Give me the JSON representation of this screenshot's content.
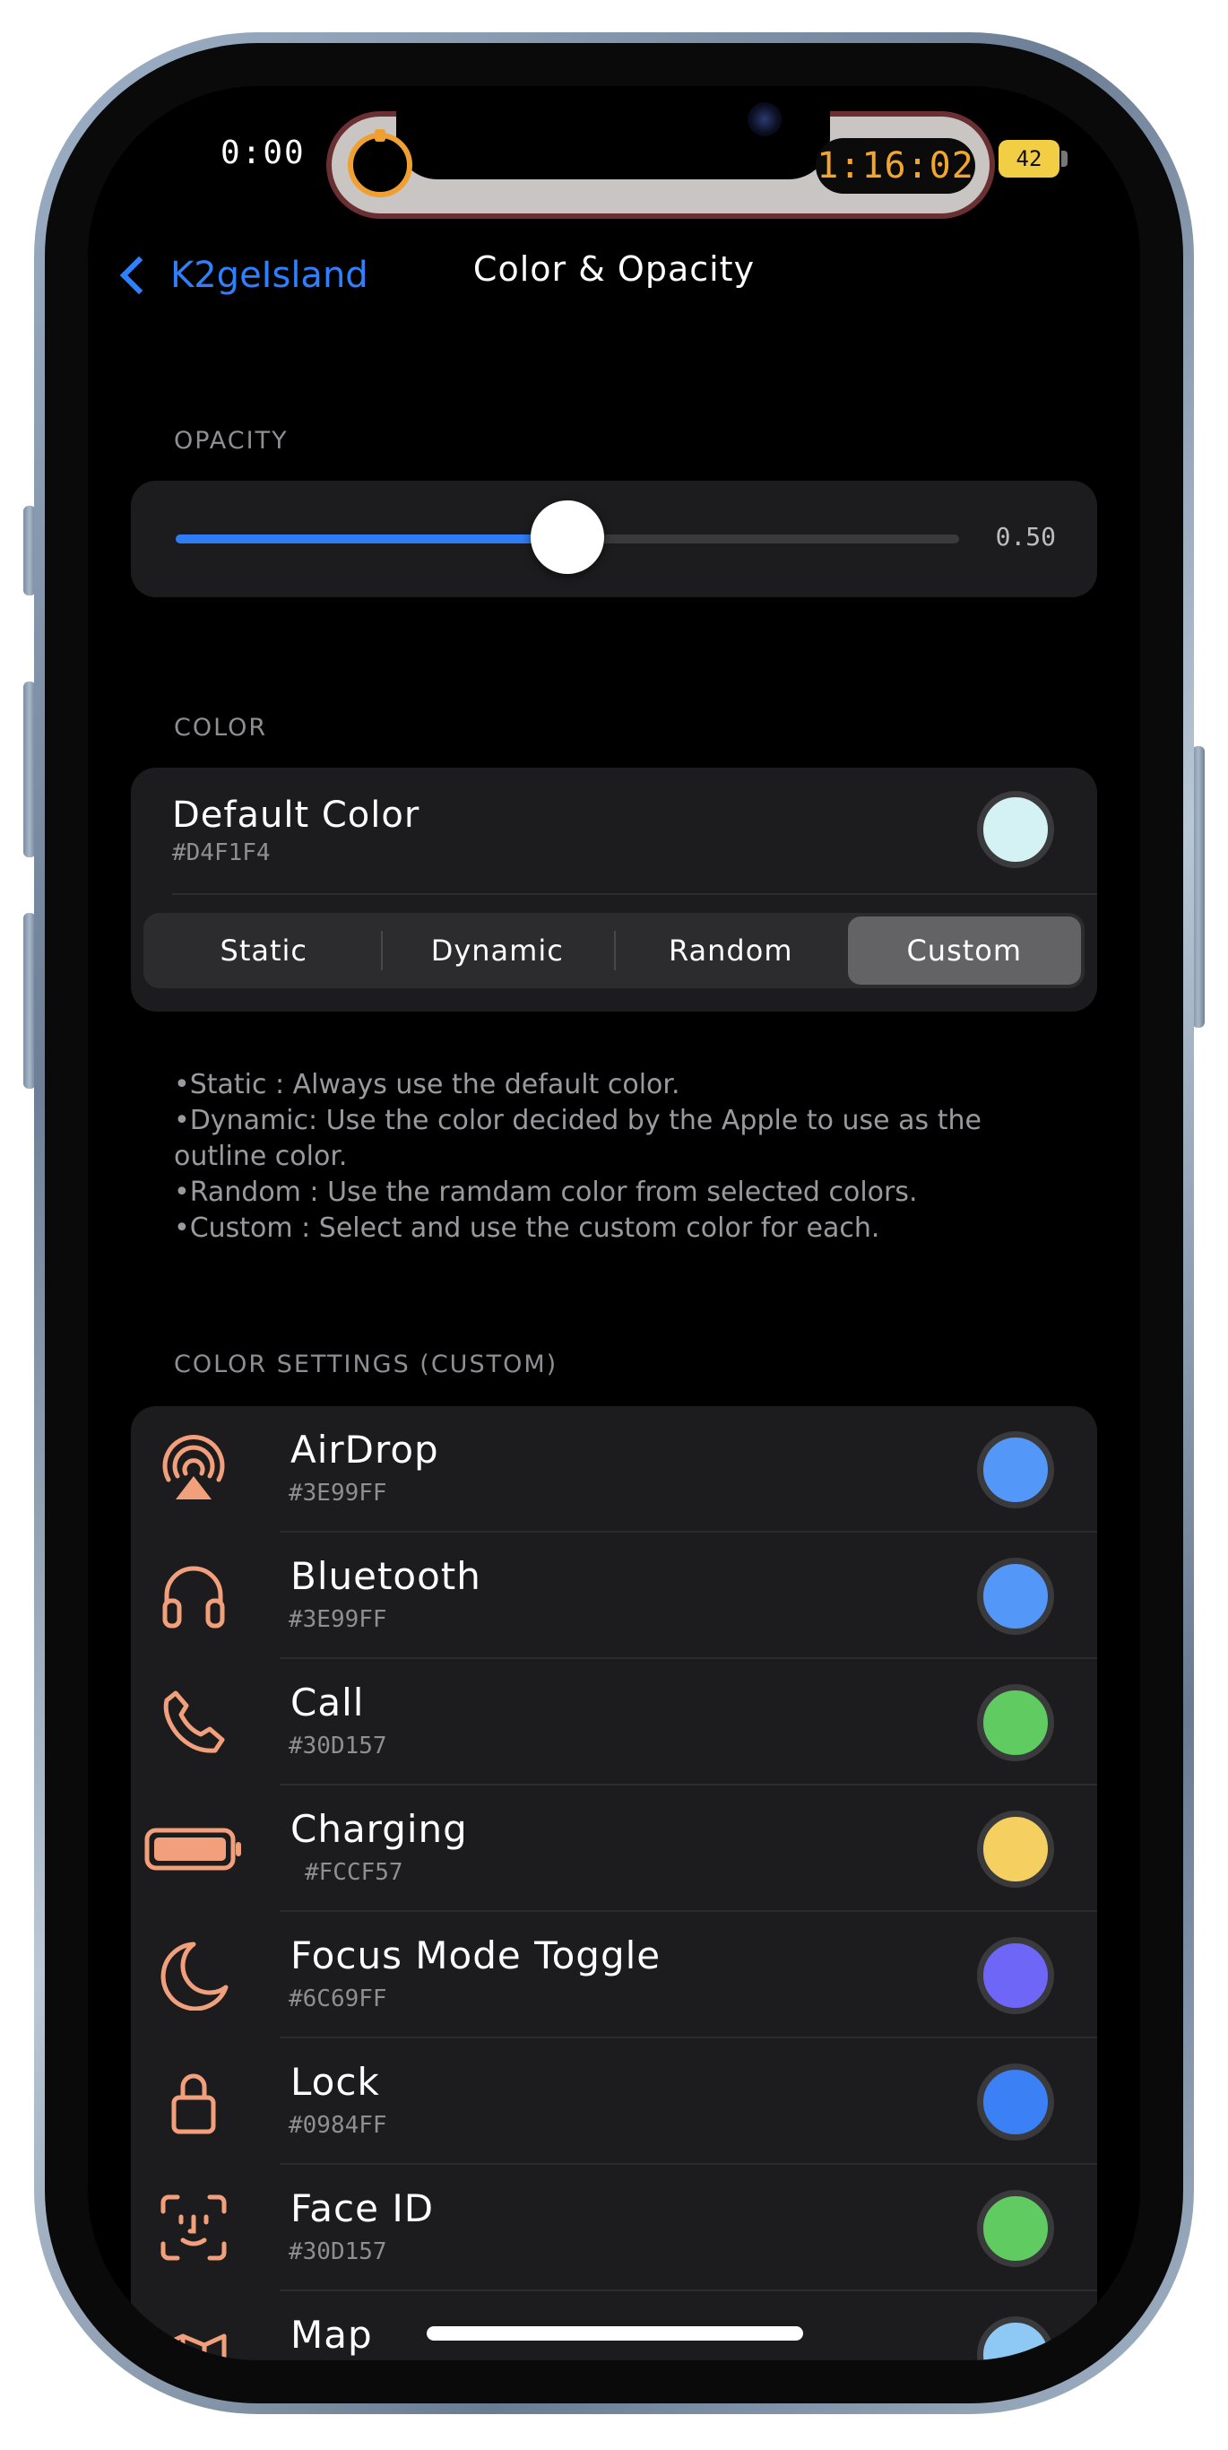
{
  "status": {
    "time": "0:00",
    "island_timer": "1:16:02",
    "battery": "42"
  },
  "nav": {
    "back_label": "K2geIsland",
    "title": "Color & Opacity"
  },
  "opacity": {
    "header": "OPACITY",
    "value": 0.5,
    "value_label": "0.50"
  },
  "color": {
    "header": "COLOR",
    "default_title": "Default Color",
    "default_hex": "#D4F1F4",
    "default_swatch": "#D4F1F4",
    "segments": [
      "Static",
      "Dynamic",
      "Random",
      "Custom"
    ],
    "selected_segment": "Custom",
    "notes": [
      "•Static : Always use the default color.",
      "•Dynamic: Use the color decided by the Apple to use as the",
      "outline color.",
      "•Random : Use the ramdam color from selected colors.",
      "•Custom : Select and use the custom color for each."
    ]
  },
  "custom": {
    "header": "COLOR SETTINGS (CUSTOM)",
    "icon_color": "#F2A07B",
    "items": [
      {
        "label": "AirDrop",
        "hex": "#3E99FF",
        "swatch": "#5397F8",
        "icon": "airdrop-icon"
      },
      {
        "label": "Bluetooth",
        "hex": "#3E99FF",
        "swatch": "#5397F8",
        "icon": "headphones-icon"
      },
      {
        "label": "Call",
        "hex": "#30D157",
        "swatch": "#5FCB60",
        "icon": "phone-icon"
      },
      {
        "label": "Charging",
        "hex": "#FCCF57",
        "swatch": "#F5D061",
        "icon": "battery-icon"
      },
      {
        "label": "Focus Mode Toggle",
        "hex": "#6C69FF",
        "swatch": "#6E66F6",
        "icon": "moon-icon"
      },
      {
        "label": "Lock",
        "hex": "#0984FF",
        "swatch": "#3C80F5",
        "icon": "lock-icon"
      },
      {
        "label": "Face ID",
        "hex": "#30D157",
        "swatch": "#5FCB60",
        "icon": "faceid-icon"
      },
      {
        "label": "Map",
        "hex": "",
        "swatch": "#8EC8F5",
        "icon": "map-icon"
      }
    ]
  }
}
